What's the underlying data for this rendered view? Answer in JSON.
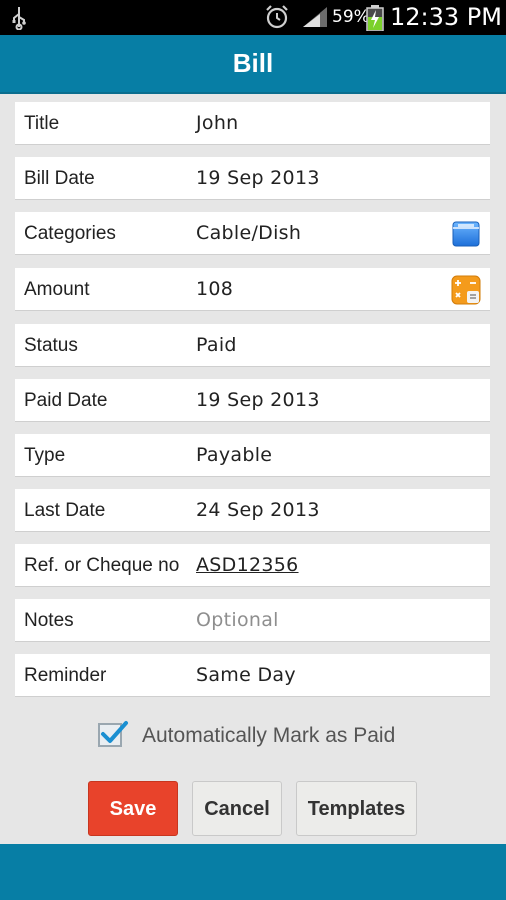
{
  "status_bar": {
    "battery_percent": "59%",
    "time": "12:33 PM",
    "icons": [
      "usb-icon",
      "alarm-icon",
      "signal-icon",
      "battery-charging-icon"
    ]
  },
  "header": {
    "title": "Bill"
  },
  "form": {
    "rows": [
      {
        "label": "Title",
        "value": "John"
      },
      {
        "label": "Bill Date",
        "value": "19  Sep  2013"
      },
      {
        "label": "Categories",
        "value": "Cable/Dish",
        "icon": "folder-icon"
      },
      {
        "label": "Amount",
        "value": "108",
        "icon": "calculator-icon"
      },
      {
        "label": "Status",
        "value": "Paid"
      },
      {
        "label": "Paid Date",
        "value": "19  Sep  2013"
      },
      {
        "label": "Type",
        "value": "Payable"
      },
      {
        "label": "Last Date",
        "value": "24  Sep  2013"
      },
      {
        "label": "Ref. or Cheque no",
        "value": "ASD12356"
      },
      {
        "label": "Notes",
        "placeholder": "Optional"
      },
      {
        "label": "Reminder",
        "value": "Same Day"
      }
    ]
  },
  "auto_mark": {
    "label": "Automatically Mark as Paid",
    "checked": true
  },
  "actions": {
    "save": "Save",
    "cancel": "Cancel",
    "templates": "Templates"
  },
  "colors": {
    "primary": "#077ea5",
    "save": "#e8432b",
    "background": "#e6e6e6"
  }
}
